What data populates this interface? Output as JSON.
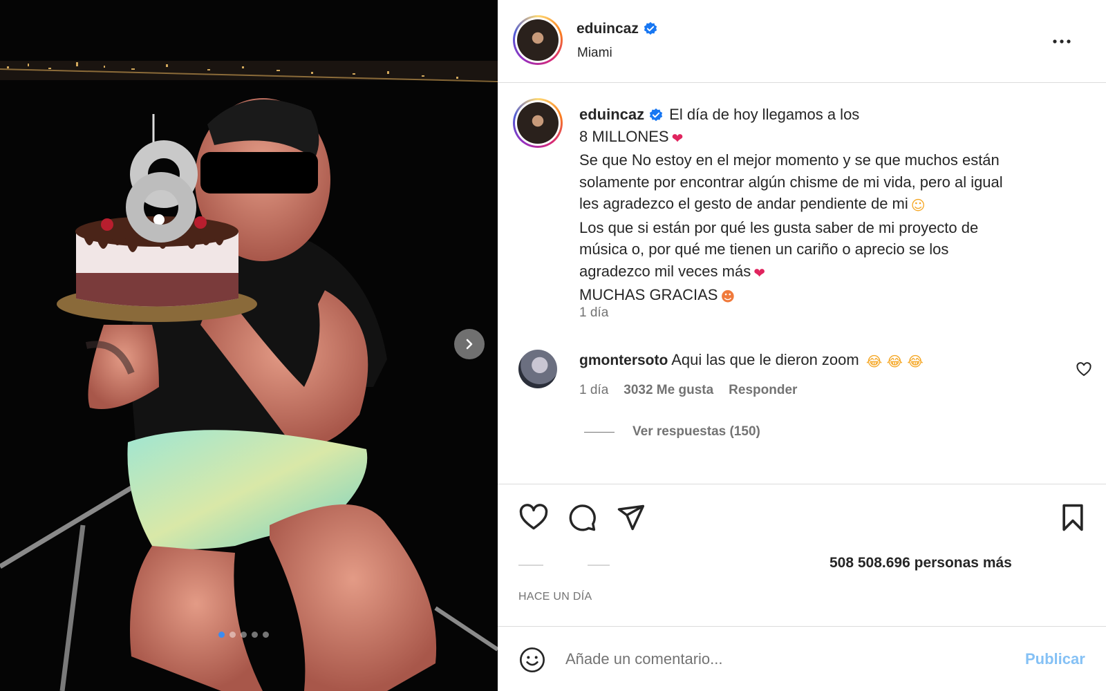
{
  "post": {
    "username": "eduincaz",
    "location": "Miami",
    "verified": true
  },
  "caption": {
    "username": "eduincaz",
    "line1": "El día de hoy llegamos a los",
    "line2": "8 MILLONES",
    "line3": "Se que No estoy en el mejor momento y se que muchos están",
    "line4": "solamente por encontrar algún chisme de mi vida, pero al igual",
    "line5": "les agradezco el gesto de andar pendiente de mi",
    "line6": "Los que si están por qué les gusta saber de mi proyecto de",
    "line7": "música o, por qué me tienen un cariño o aprecio se los",
    "line8": "agradezco mil veces más",
    "line9": "MUCHAS GRACIAS",
    "time": "1 día",
    "emojis": {
      "heart": "❤",
      "smile": "☺",
      "hug": "☻"
    }
  },
  "comment": {
    "username": "gmontersoto",
    "text": "Aqui las que le dieron zoom",
    "emoji": "😂 😂 😂",
    "time": "1 día",
    "likes": "3032 Me gusta",
    "reply": "Responder",
    "view_replies": "Ver respuestas (150)"
  },
  "actions": {
    "likes_text": "508 508.696 personas más",
    "timestamp": "HACE UN DÍA"
  },
  "add_comment": {
    "placeholder": "Añade un comentario...",
    "publish": "Publicar"
  },
  "carousel": {
    "total": 5,
    "current": 1
  },
  "colors": {
    "verified": "#1877f2",
    "link": "#85c1f5",
    "secondary": "#737373",
    "heart": "#e0245e"
  },
  "icons": [
    "more-icon",
    "verified-icon",
    "like-icon",
    "comment-icon",
    "share-icon",
    "save-icon",
    "emoji-icon",
    "next-icon",
    "small-heart-icon"
  ]
}
